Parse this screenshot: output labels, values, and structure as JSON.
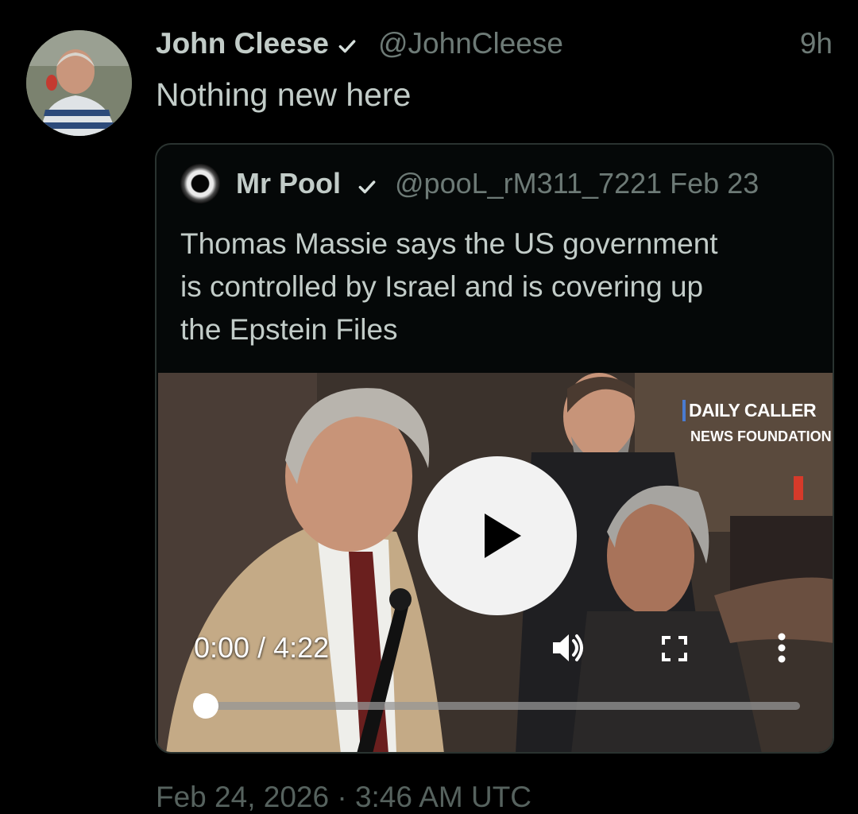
{
  "tweet": {
    "author_name": "John Cleese",
    "author_handle": "@JohnCleese",
    "relative_time": "9h",
    "text": "Nothing new here",
    "timestamp": "Feb 24, 2026 · 3:46 AM UTC",
    "verified": true
  },
  "quoted_tweet": {
    "author_name": "Mr Pool",
    "author_handle": "@pooL_rM311_7221",
    "date": "Feb 23",
    "verified": true,
    "text_lines": [
      "Thomas Massie says the US government",
      "is controlled by Israel and is covering up",
      "the Epstein Files"
    ]
  },
  "video": {
    "watermark_line1": "DAILY CALLER",
    "watermark_line2": "NEWS FOUNDATION",
    "time_display": "0:00 / 4:22",
    "progress_fraction": 0.0,
    "icons": [
      "play-icon",
      "volume-icon",
      "fullscreen-icon",
      "more-vertical-icon"
    ]
  },
  "colors": {
    "background": "#000000",
    "primary_text": "#c2ccc8",
    "secondary_text": "#6d7a76",
    "border": "#2a3330"
  }
}
